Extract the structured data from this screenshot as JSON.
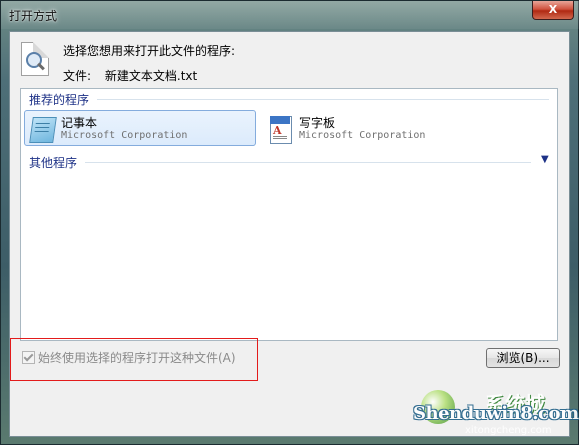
{
  "window": {
    "title": "打开方式",
    "close_label": "X"
  },
  "header": {
    "prompt": "选择您想用来打开此文件的程序:",
    "file_label": "文件:",
    "file_name": "新建文本文档.txt"
  },
  "recommended": {
    "label": "推荐的程序",
    "programs": [
      {
        "name": "记事本",
        "publisher": "Microsoft Corporation",
        "icon": "notepad-icon",
        "selected": true
      },
      {
        "name": "写字板",
        "publisher": "Microsoft Corporation",
        "icon": "wordpad-icon",
        "selected": false
      }
    ]
  },
  "other": {
    "label": "其他程序",
    "expand_icon": "chevron-down-icon"
  },
  "options": {
    "always_use_label": "始终使用选择的程序打开这种文件(A)",
    "always_use_checked": true,
    "always_use_enabled": false
  },
  "buttons": {
    "browse_label": "浏览(B)..."
  },
  "watermark": {
    "main": "Shenduwin8.com",
    "cn": "系统城",
    "sub": "xitongcheng.com"
  },
  "colors": {
    "highlight_box": "#e31b1b",
    "group_header": "#1e3287",
    "selection": "#dcebfc"
  }
}
